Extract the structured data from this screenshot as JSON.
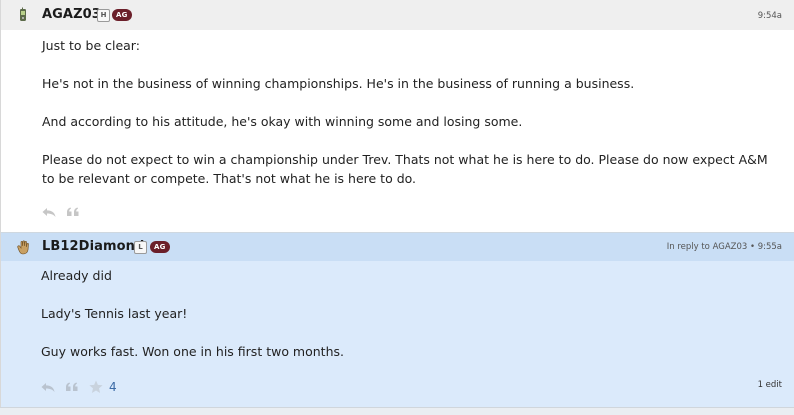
{
  "posts": [
    {
      "username": "AGAZ03",
      "avatar_icon": "phone-icon",
      "role_badge": "H",
      "group_badge": "AG",
      "timestamp": "9:54a",
      "paragraphs": [
        "Just to be clear:",
        "He's not in the business of winning championships. He's in the business of running a business.",
        "And according to his attitude, he's okay with winning some and losing some.",
        "Please do not expect to win a championship under Trev. Thats not what he is here to do. Please do now expect A&M to be relevant or compete. That's not what he is here to do."
      ],
      "actions": [
        "reply-icon",
        "quote-icon"
      ]
    },
    {
      "username": "LB12Diamond",
      "avatar_icon": "hand-icon",
      "role_badge": "L",
      "group_badge": "AG",
      "meta": "In reply to AGAZ03 • 9:55a",
      "paragraphs": [
        "Already did",
        "Lady's Tennis last year!",
        "Guy works fast. Won one in his first two months."
      ],
      "actions": [
        "reply-icon",
        "quote-icon",
        "star-icon"
      ],
      "like_count": "4",
      "edit_note": "1 edit"
    }
  ],
  "colors": {
    "header_grey": "#efefef",
    "reply_blue": "#dbeafb",
    "reply_header_blue": "#c9def5",
    "ag_badge": "#6b1f2a",
    "link_blue": "#3b6aa5"
  }
}
